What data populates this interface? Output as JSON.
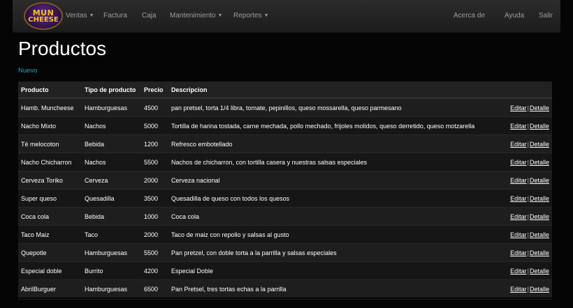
{
  "brand": {
    "line1": "MUN",
    "line2": "CHEESE"
  },
  "nav": {
    "left": [
      {
        "label": "Ventas",
        "dropdown": true
      },
      {
        "label": "Factura",
        "dropdown": false
      },
      {
        "label": "Caja",
        "dropdown": false
      },
      {
        "label": "Mantenimiento",
        "dropdown": true
      },
      {
        "label": "Reportes",
        "dropdown": true
      }
    ],
    "right": [
      {
        "label": "Acerca de"
      },
      {
        "label": "Ayuda"
      },
      {
        "label": "Salir"
      }
    ]
  },
  "page": {
    "title": "Productos",
    "new_link": "Nuevo"
  },
  "table": {
    "headers": [
      "Producto",
      "Tipo de producto",
      "Precio",
      "Descripcion",
      ""
    ],
    "action_labels": {
      "edit": "Editar",
      "separator": "|",
      "detail": "Detalle"
    },
    "rows": [
      {
        "producto": "Hamb. Muncheese",
        "tipo": "Hamburguesas",
        "precio": "4500",
        "descripcion": "pan pretsel, torta 1/4 libra, tomate, pepinillos, queso mossarella, queso parmesano"
      },
      {
        "producto": "Nacho Mixto",
        "tipo": "Nachos",
        "precio": "5000",
        "descripcion": "Tortilla de harina tostada, carne mechada, pollo mechado, frijoles molidos, queso derretido, queso motzarella"
      },
      {
        "producto": "Té melocoton",
        "tipo": "Bebida",
        "precio": "1200",
        "descripcion": "Refresco embotellado"
      },
      {
        "producto": "Nacho Chicharron",
        "tipo": "Nachos",
        "precio": "5500",
        "descripcion": "Nachos de chicharron, con tortilla casera y nuestras salsas especiales"
      },
      {
        "producto": "Cerveza Toriko",
        "tipo": "Cerveza",
        "precio": "2000",
        "descripcion": "Cerveza nacional"
      },
      {
        "producto": "Super queso",
        "tipo": "Quesadilla",
        "precio": "3500",
        "descripcion": "Quesadilla de queso con todos los quesos"
      },
      {
        "producto": "Coca cola",
        "tipo": "Bebida",
        "precio": "1000",
        "descripcion": "Coca cola"
      },
      {
        "producto": "Taco Maiz",
        "tipo": "Taco",
        "precio": "2000",
        "descripcion": "Taco de maiz con repollo y salsas al gusto"
      },
      {
        "producto": "Quepotle",
        "tipo": "Hamburguesas",
        "precio": "5500",
        "descripcion": "Pan pretzel, con doble torta a la parrilla y salsas especiales"
      },
      {
        "producto": "Especial doble",
        "tipo": "Burrito",
        "precio": "4200",
        "descripcion": "Especial Doble"
      },
      {
        "producto": "AbrilBurguer",
        "tipo": "Hamburguesas",
        "precio": "6500",
        "descripcion": "Pan Pretsel, tres tortas echas a la parrilla"
      }
    ]
  }
}
